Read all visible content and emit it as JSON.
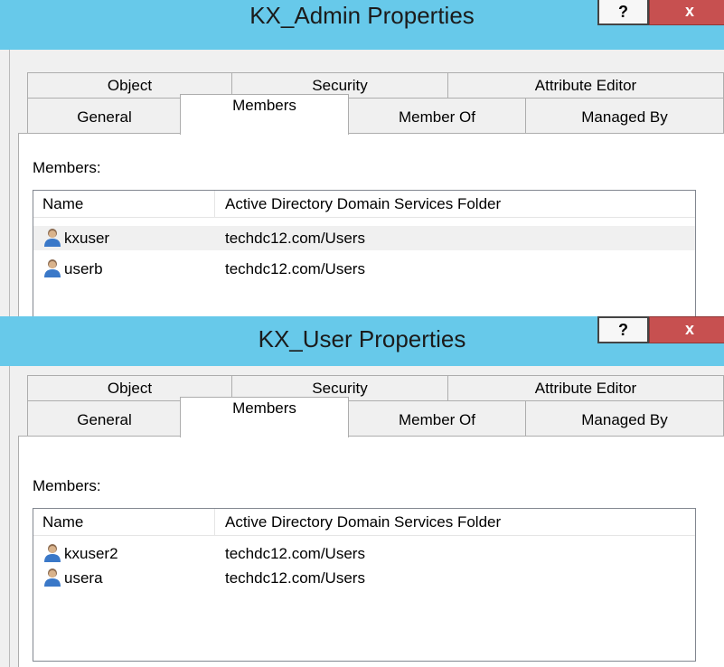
{
  "dialogs": [
    {
      "title": "KX_Admin Properties",
      "help_label": "?",
      "close_label": "x",
      "tabs_row1": [
        "Object",
        "Security",
        "Attribute Editor"
      ],
      "tabs_row2": [
        "General",
        "Members",
        "Member Of",
        "Managed By"
      ],
      "active_tab": "Members",
      "members_label": "Members:",
      "columns": [
        "Name",
        "Active Directory Domain Services Folder"
      ],
      "rows": [
        {
          "name": "kxuser",
          "folder": "techdc12.com/Users",
          "selected": true,
          "icon": "user-icon"
        },
        {
          "name": "userb",
          "folder": "techdc12.com/Users",
          "selected": false,
          "icon": "user-icon"
        }
      ]
    },
    {
      "title": "KX_User Properties",
      "help_label": "?",
      "close_label": "x",
      "tabs_row1": [
        "Object",
        "Security",
        "Attribute Editor"
      ],
      "tabs_row2": [
        "General",
        "Members",
        "Member Of",
        "Managed By"
      ],
      "active_tab": "Members",
      "members_label": "Members:",
      "columns": [
        "Name",
        "Active Directory Domain Services Folder"
      ],
      "rows": [
        {
          "name": "kxuser2",
          "folder": "techdc12.com/Users",
          "selected": false,
          "icon": "user-icon"
        },
        {
          "name": "usera",
          "folder": "techdc12.com/Users",
          "selected": false,
          "icon": "user-icon"
        }
      ]
    }
  ],
  "colors": {
    "titlebar": "#67c9ea",
    "close_button": "#c75050",
    "dialog_background": "#f0f0f0",
    "selected_row": "#f0f0f0"
  }
}
